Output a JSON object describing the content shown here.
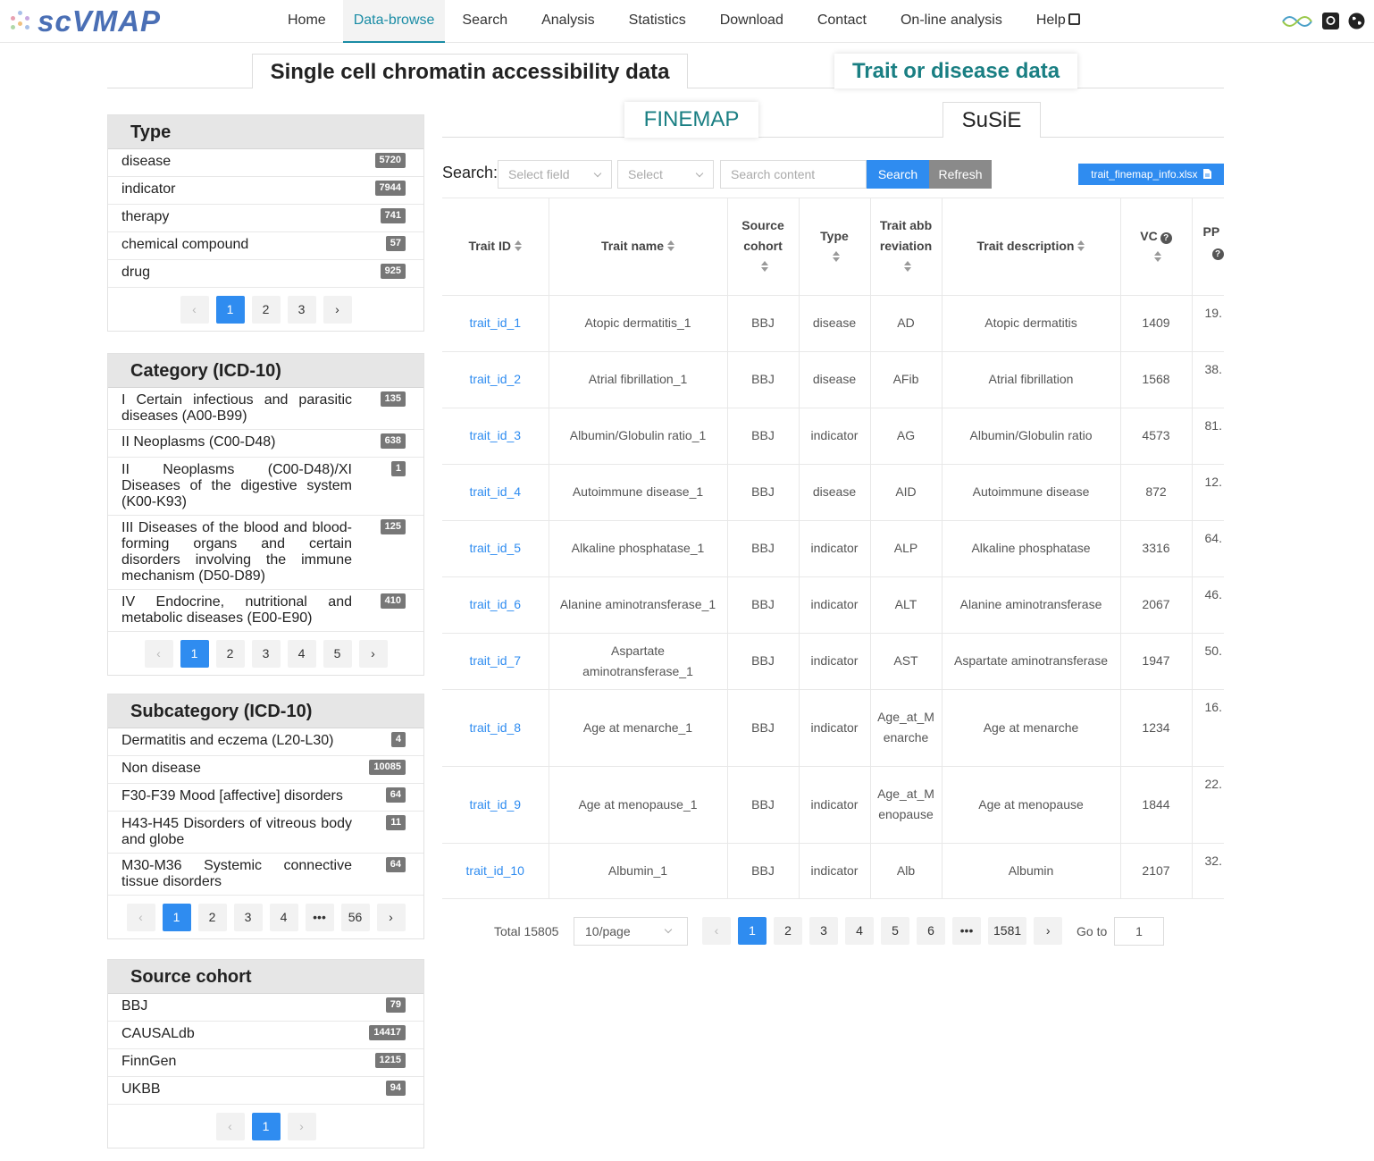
{
  "header": {
    "logo_text": "scVMAP",
    "nav": [
      "Home",
      "Data-browse",
      "Search",
      "Analysis",
      "Statistics",
      "Download",
      "Contact",
      "On-line analysis",
      "Help"
    ],
    "active_nav": "Data-browse"
  },
  "main_tabs": {
    "sc": "Single cell chromatin accessibility data",
    "trait": "Trait or disease data"
  },
  "sub_tabs": {
    "finemap": "FINEMAP",
    "susie": "SuSiE"
  },
  "facets": {
    "type": {
      "title": "Type",
      "items": [
        {
          "label": "disease",
          "count": "5720"
        },
        {
          "label": "indicator",
          "count": "7944"
        },
        {
          "label": "therapy",
          "count": "741"
        },
        {
          "label": "chemical compound",
          "count": "57"
        },
        {
          "label": "drug",
          "count": "925"
        }
      ],
      "pages": [
        "1",
        "2",
        "3"
      ]
    },
    "category": {
      "title": "Category (ICD-10)",
      "items": [
        {
          "label": "I Certain infectious and parasitic diseases (A00-B99)",
          "count": "135"
        },
        {
          "label": "II Neoplasms (C00-D48)",
          "count": "638"
        },
        {
          "label": "II Neoplasms (C00-D48)/XI Diseases of the digestive system (K00-K93)",
          "count": "1"
        },
        {
          "label": "III Diseases of the blood and blood-forming organs and certain disorders involving the immune mechanism (D50-D89)",
          "count": "125"
        },
        {
          "label": "IV Endocrine, nutritional and metabolic diseases (E00-E90)",
          "count": "410"
        }
      ],
      "pages": [
        "1",
        "2",
        "3",
        "4",
        "5"
      ]
    },
    "subcategory": {
      "title": "Subcategory (ICD-10)",
      "items": [
        {
          "label": "Dermatitis and eczema (L20-L30)",
          "count": "4"
        },
        {
          "label": "Non disease",
          "count": "10085"
        },
        {
          "label": "F30-F39 Mood [affective] disorders",
          "count": "64"
        },
        {
          "label": "H43-H45 Disorders of vitreous body and globe",
          "count": "11"
        },
        {
          "label": "M30-M36 Systemic connective tissue disorders",
          "count": "64"
        }
      ],
      "pages": [
        "1",
        "2",
        "3",
        "4",
        "•••",
        "56"
      ]
    },
    "cohort": {
      "title": "Source cohort",
      "items": [
        {
          "label": "BBJ",
          "count": "79"
        },
        {
          "label": "CAUSALdb",
          "count": "14417"
        },
        {
          "label": "FinnGen",
          "count": "1215"
        },
        {
          "label": "UKBB",
          "count": "94"
        }
      ],
      "pages": [
        "1"
      ]
    }
  },
  "search": {
    "label": "Search:",
    "field_placeholder": "Select field",
    "select_placeholder": "Select",
    "content_placeholder": "Search content",
    "search_btn": "Search",
    "refresh_btn": "Refresh",
    "download_btn": "trait_finemap_info.xlsx"
  },
  "table": {
    "columns": [
      "Trait ID",
      "Trait name",
      "Source cohort",
      "Type",
      "Trait abbreviation",
      "Trait description",
      "VC",
      "PP"
    ],
    "rows": [
      [
        "trait_id_1",
        "Atopic dermatitis_1",
        "BBJ",
        "disease",
        "AD",
        "Atopic dermatitis",
        "1409",
        "19."
      ],
      [
        "trait_id_2",
        "Atrial fibrillation_1",
        "BBJ",
        "disease",
        "AFib",
        "Atrial fibrillation",
        "1568",
        "38."
      ],
      [
        "trait_id_3",
        "Albumin/Globulin ratio_1",
        "BBJ",
        "indicator",
        "AG",
        "Albumin/Globulin ratio",
        "4573",
        "81."
      ],
      [
        "trait_id_4",
        "Autoimmune disease_1",
        "BBJ",
        "disease",
        "AID",
        "Autoimmune disease",
        "872",
        "12."
      ],
      [
        "trait_id_5",
        "Alkaline phosphatase_1",
        "BBJ",
        "indicator",
        "ALP",
        "Alkaline phosphatase",
        "3316",
        "64."
      ],
      [
        "trait_id_6",
        "Alanine aminotransferase_1",
        "BBJ",
        "indicator",
        "ALT",
        "Alanine aminotransferase",
        "2067",
        "46."
      ],
      [
        "trait_id_7",
        "Aspartate aminotransferase_1",
        "BBJ",
        "indicator",
        "AST",
        "Aspartate aminotransferase",
        "1947",
        "50."
      ],
      [
        "trait_id_8",
        "Age at menarche_1",
        "BBJ",
        "indicator",
        "Age_at_Menarche",
        "Age at menarche",
        "1234",
        "16."
      ],
      [
        "trait_id_9",
        "Age at menopause_1",
        "BBJ",
        "indicator",
        "Age_at_Menopause",
        "Age at menopause",
        "1844",
        "22."
      ],
      [
        "trait_id_10",
        "Albumin_1",
        "BBJ",
        "indicator",
        "Alb",
        "Albumin",
        "2107",
        "32."
      ]
    ]
  },
  "pagination": {
    "total": "Total 15805",
    "page_size": "10/page",
    "pages": [
      "1",
      "2",
      "3",
      "4",
      "5",
      "6",
      "•••",
      "1581"
    ],
    "goto_label": "Go to",
    "goto_value": "1"
  }
}
